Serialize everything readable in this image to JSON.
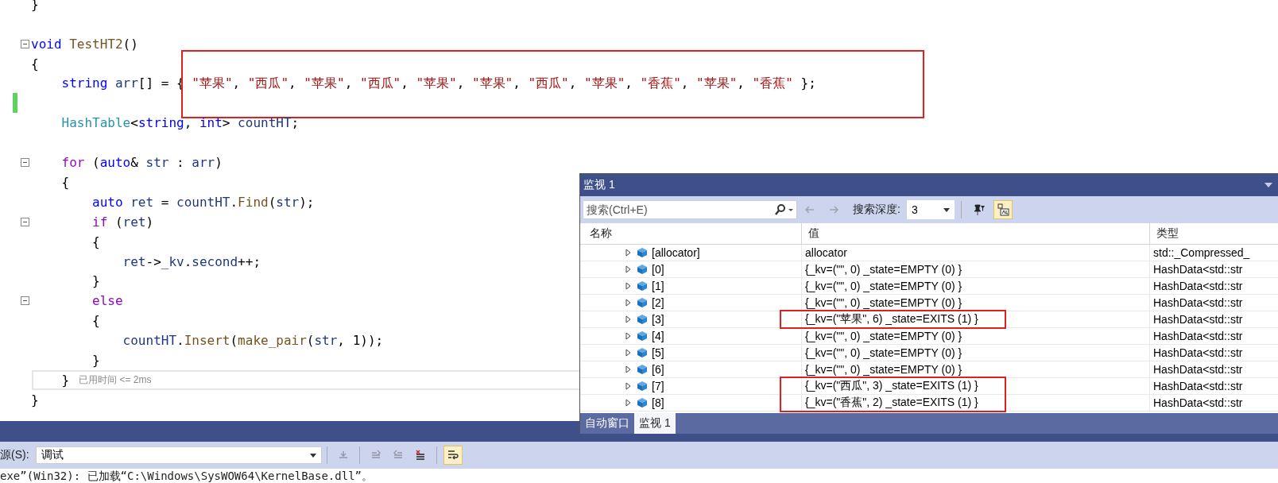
{
  "editor": {
    "lines": [
      {
        "tokens": [
          {
            "text": "}",
            "kind": "plain"
          }
        ],
        "fold": false,
        "changed": false,
        "current": false,
        "highlighted": false
      },
      {
        "fold": false,
        "changed": false,
        "current": false,
        "highlighted": false
      },
      {
        "tokens": [
          {
            "text": "void",
            "kind": "kw"
          },
          {
            "text": " TestHT2",
            "kind": "fn"
          },
          {
            "text": "()",
            "kind": "plain"
          }
        ],
        "fold": true,
        "changed": false,
        "current": false,
        "highlighted": false
      },
      {
        "tokens": [
          {
            "text": "{",
            "kind": "plain"
          }
        ],
        "fold": false,
        "changed": false,
        "current": false,
        "highlighted": false
      },
      {
        "tokens": [
          {
            "text": "    string",
            "kind": "kw"
          },
          {
            "text": " arr",
            "kind": "var"
          },
          {
            "text": "[] = { ",
            "kind": "plain"
          },
          {
            "text": "\"苹果\"",
            "kind": "str"
          },
          {
            "text": ", ",
            "kind": "plain"
          },
          {
            "text": "\"西瓜\"",
            "kind": "str"
          },
          {
            "text": ", ",
            "kind": "plain"
          },
          {
            "text": "\"苹果\"",
            "kind": "str"
          },
          {
            "text": ", ",
            "kind": "plain"
          },
          {
            "text": "\"西瓜\"",
            "kind": "str"
          },
          {
            "text": ", ",
            "kind": "plain"
          },
          {
            "text": "\"苹果\"",
            "kind": "str"
          },
          {
            "text": ", ",
            "kind": "plain"
          },
          {
            "text": "\"苹果\"",
            "kind": "str"
          },
          {
            "text": ", ",
            "kind": "plain"
          },
          {
            "text": "\"西瓜\"",
            "kind": "str"
          },
          {
            "text": ", ",
            "kind": "plain"
          },
          {
            "text": "\"苹果\"",
            "kind": "str"
          },
          {
            "text": ", ",
            "kind": "plain"
          },
          {
            "text": "\"香蕉\"",
            "kind": "str"
          },
          {
            "text": ", ",
            "kind": "plain"
          },
          {
            "text": "\"苹果\"",
            "kind": "str"
          },
          {
            "text": ", ",
            "kind": "plain"
          },
          {
            "text": "\"香蕉\"",
            "kind": "str"
          },
          {
            "text": " };",
            "kind": "plain"
          }
        ],
        "fold": false,
        "changed": false,
        "current": false,
        "highlighted": true
      },
      {
        "fold": false,
        "changed": true,
        "current": false,
        "highlighted": false
      },
      {
        "tokens": [
          {
            "text": "    HashTable",
            "kind": "type"
          },
          {
            "text": "<",
            "kind": "plain"
          },
          {
            "text": "string",
            "kind": "kw"
          },
          {
            "text": ", ",
            "kind": "plain"
          },
          {
            "text": "int",
            "kind": "kw"
          },
          {
            "text": "> ",
            "kind": "plain"
          },
          {
            "text": "countHT",
            "kind": "var"
          },
          {
            "text": ";",
            "kind": "plain"
          }
        ],
        "fold": false,
        "changed": false,
        "current": false,
        "highlighted": false
      },
      {
        "fold": false,
        "changed": false,
        "current": false,
        "highlighted": false
      },
      {
        "tokens": [
          {
            "text": "    for",
            "kind": "ctl"
          },
          {
            "text": " (",
            "kind": "plain"
          },
          {
            "text": "auto",
            "kind": "kw"
          },
          {
            "text": "& ",
            "kind": "plain"
          },
          {
            "text": "str",
            "kind": "var"
          },
          {
            "text": " : ",
            "kind": "plain"
          },
          {
            "text": "arr",
            "kind": "var"
          },
          {
            "text": ")",
            "kind": "plain"
          }
        ],
        "fold": true,
        "changed": false,
        "current": false,
        "highlighted": false
      },
      {
        "tokens": [
          {
            "text": "    {",
            "kind": "plain"
          }
        ],
        "fold": false,
        "changed": false,
        "current": false,
        "highlighted": false
      },
      {
        "tokens": [
          {
            "text": "        auto",
            "kind": "kw"
          },
          {
            "text": " ret",
            "kind": "var"
          },
          {
            "text": " = ",
            "kind": "plain"
          },
          {
            "text": "countHT",
            "kind": "var"
          },
          {
            "text": ".",
            "kind": "plain"
          },
          {
            "text": "Find",
            "kind": "fn"
          },
          {
            "text": "(",
            "kind": "plain"
          },
          {
            "text": "str",
            "kind": "var"
          },
          {
            "text": ");",
            "kind": "plain"
          }
        ],
        "fold": false,
        "changed": false,
        "current": false,
        "highlighted": false
      },
      {
        "tokens": [
          {
            "text": "        if",
            "kind": "ctl"
          },
          {
            "text": " (",
            "kind": "plain"
          },
          {
            "text": "ret",
            "kind": "var"
          },
          {
            "text": ")",
            "kind": "plain"
          }
        ],
        "fold": true,
        "changed": false,
        "current": false,
        "highlighted": false
      },
      {
        "tokens": [
          {
            "text": "        {",
            "kind": "plain"
          }
        ],
        "fold": false,
        "changed": false,
        "current": false,
        "highlighted": false
      },
      {
        "tokens": [
          {
            "text": "            ret",
            "kind": "var"
          },
          {
            "text": "->",
            "kind": "plain"
          },
          {
            "text": "_kv",
            "kind": "var"
          },
          {
            "text": ".",
            "kind": "plain"
          },
          {
            "text": "second",
            "kind": "var"
          },
          {
            "text": "++;",
            "kind": "plain"
          }
        ],
        "fold": false,
        "changed": false,
        "current": false,
        "highlighted": false
      },
      {
        "tokens": [
          {
            "text": "        }",
            "kind": "plain"
          }
        ],
        "fold": false,
        "changed": false,
        "current": false,
        "highlighted": false
      },
      {
        "tokens": [
          {
            "text": "        else",
            "kind": "ctl"
          }
        ],
        "fold": true,
        "changed": false,
        "current": false,
        "highlighted": false
      },
      {
        "tokens": [
          {
            "text": "        {",
            "kind": "plain"
          }
        ],
        "fold": false,
        "changed": false,
        "current": false,
        "highlighted": false
      },
      {
        "tokens": [
          {
            "text": "            countHT",
            "kind": "var"
          },
          {
            "text": ".",
            "kind": "plain"
          },
          {
            "text": "Insert",
            "kind": "fn"
          },
          {
            "text": "(",
            "kind": "plain"
          },
          {
            "text": "make_pair",
            "kind": "fn"
          },
          {
            "text": "(",
            "kind": "plain"
          },
          {
            "text": "str",
            "kind": "var"
          },
          {
            "text": ", 1));",
            "kind": "plain"
          }
        ],
        "fold": false,
        "changed": false,
        "current": false,
        "highlighted": false
      },
      {
        "tokens": [
          {
            "text": "        }",
            "kind": "plain"
          }
        ],
        "fold": false,
        "changed": false,
        "current": false,
        "highlighted": false
      },
      {
        "tokens": [
          {
            "text": "    }",
            "kind": "plain"
          }
        ],
        "hint": "已用时间 <= 2ms",
        "fold": false,
        "changed": false,
        "current": true,
        "highlighted": false
      },
      {
        "tokens": [
          {
            "text": "}",
            "kind": "plain"
          }
        ],
        "fold": false,
        "changed": false,
        "current": false,
        "highlighted": false
      }
    ]
  },
  "watch": {
    "title": "监视 1",
    "search": {
      "placeholder": "搜索(Ctrl+E)"
    },
    "nav": [
      {
        "kind": "back",
        "disabled": true
      },
      {
        "kind": "forward",
        "disabled": true
      }
    ],
    "depth_label": "搜索深度:",
    "depth": "3",
    "hex_toggle": {
      "pressed": true
    },
    "columns": [
      "名称",
      "值",
      "类型"
    ],
    "rows": [
      {
        "name": "[allocator]",
        "value": "allocator",
        "type": "std::_Compressed_",
        "highlighted": false
      },
      {
        "name": "[0]",
        "value": "{_kv=(\"\", 0) _state=EMPTY (0) }",
        "type": "HashData<std::str",
        "highlighted": false
      },
      {
        "name": "[1]",
        "value": "{_kv=(\"\", 0) _state=EMPTY (0) }",
        "type": "HashData<std::str",
        "highlighted": false
      },
      {
        "name": "[2]",
        "value": "{_kv=(\"\", 0) _state=EMPTY (0) }",
        "type": "HashData<std::str",
        "highlighted": false
      },
      {
        "name": "[3]",
        "value": "{_kv=(\"苹果\", 6) _state=EXITS (1) }",
        "type": "HashData<std::str",
        "highlighted": true
      },
      {
        "name": "[4]",
        "value": "{_kv=(\"\", 0) _state=EMPTY (0) }",
        "type": "HashData<std::str",
        "highlighted": false
      },
      {
        "name": "[5]",
        "value": "{_kv=(\"\", 0) _state=EMPTY (0) }",
        "type": "HashData<std::str",
        "highlighted": false
      },
      {
        "name": "[6]",
        "value": "{_kv=(\"\", 0) _state=EMPTY (0) }",
        "type": "HashData<std::str",
        "highlighted": false
      },
      {
        "name": "[7]",
        "value": "{_kv=(\"西瓜\", 3) _state=EXITS (1) }",
        "type": "HashData<std::str",
        "highlighted": true
      },
      {
        "name": "[8]",
        "value": "{_kv=(\"香蕉\", 2) _state=EXITS (1) }",
        "type": "HashData<std::str",
        "highlighted": true
      }
    ],
    "tabs": [
      {
        "label": "自动窗口",
        "selected": false
      },
      {
        "label": "监视 1",
        "selected": true
      }
    ]
  },
  "output": {
    "source_label": "源(S):",
    "source": "调试",
    "tools": [
      {
        "kind": "goto",
        "disabled": true
      },
      {
        "kind": "prev",
        "disabled": true
      },
      {
        "kind": "next",
        "disabled": true
      },
      {
        "kind": "clear",
        "disabled": false
      }
    ],
    "wrap_toggle": {
      "pressed": true
    },
    "line": "exe”(Win32): 已加载“C:\\Windows\\SysWOW64\\KernelBase.dll”。"
  }
}
